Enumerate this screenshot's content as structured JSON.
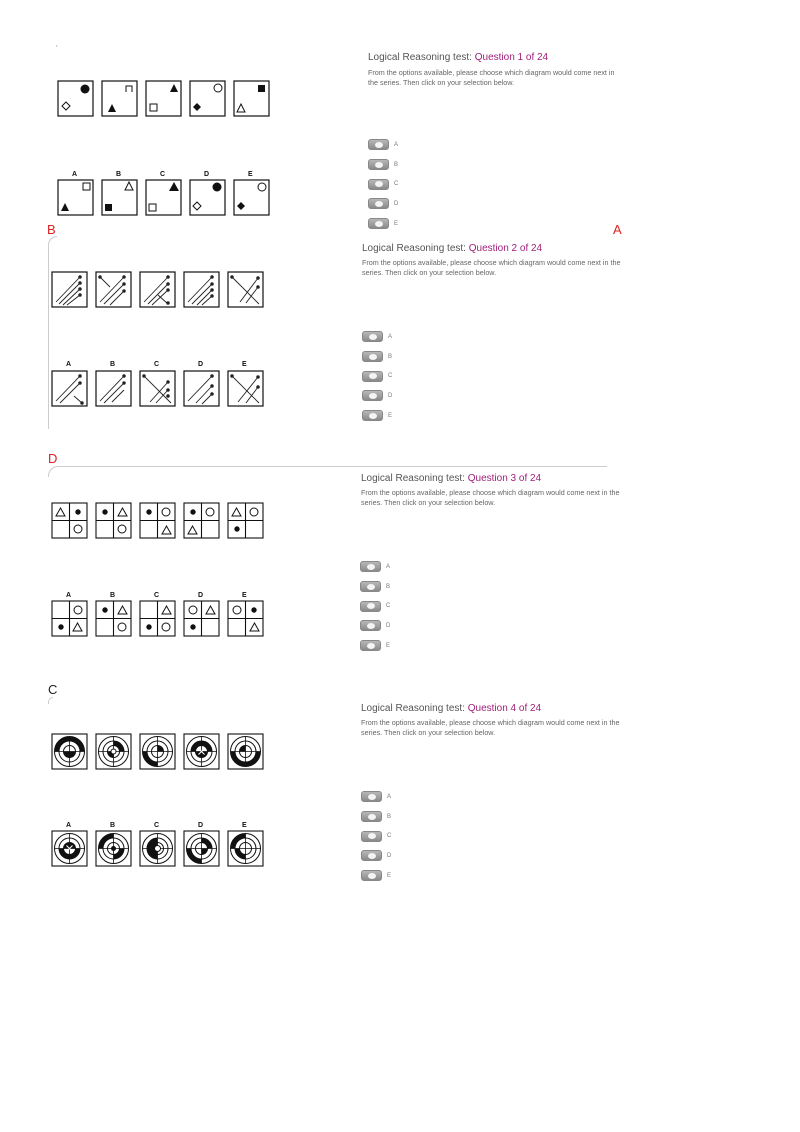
{
  "page_mark": "'",
  "answers": {
    "q1": "B",
    "q1_right": "A",
    "q2": "D",
    "q3": "C"
  },
  "option_letters": [
    "A",
    "B",
    "C",
    "D",
    "E"
  ],
  "questions": [
    {
      "title_prefix": "Logical Reasoning test: ",
      "title_number": "Question 1 of 24",
      "instructions": "From the options available, please choose which diagram would come next in the series. Then click on your selection below.",
      "options": [
        "A",
        "B",
        "C",
        "D",
        "E"
      ]
    },
    {
      "title_prefix": "Logical Reasoning test: ",
      "title_number": "Question 2 of 24",
      "instructions": "From the options available, please choose which diagram would come next in the series. Then click on your selection below.",
      "options": [
        "A",
        "B",
        "C",
        "D",
        "E"
      ]
    },
    {
      "title_prefix": "Logical Reasoning test: ",
      "title_number": "Question 3 of 24",
      "instructions": "From the options available, please choose which diagram would come next in the series. Then click on your selection below.",
      "options": [
        "A",
        "B",
        "C",
        "D",
        "E"
      ]
    },
    {
      "title_prefix": "Logical Reasoning test: ",
      "title_number": "Question 4 of 24",
      "instructions": "From the options available, please choose which diagram would come next in the series. Then click on your selection below.",
      "options": [
        "A",
        "B",
        "C",
        "D",
        "E"
      ]
    }
  ]
}
